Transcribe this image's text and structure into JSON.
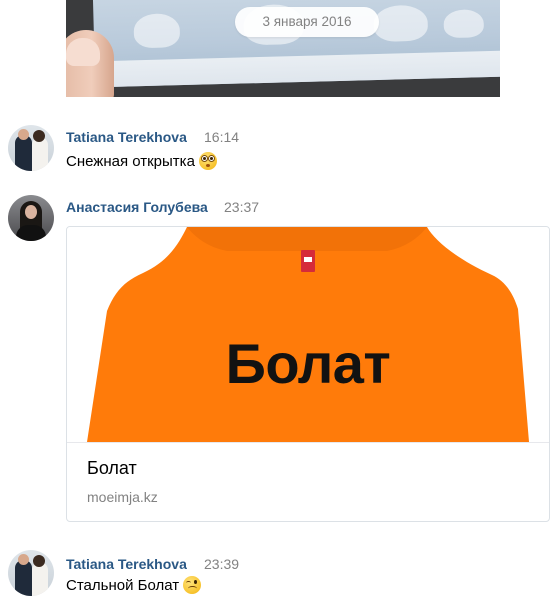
{
  "date_separator": "3 января 2016",
  "messages": [
    {
      "author": "Tatiana Terekhova",
      "time": "16:14",
      "text": "Снежная открытка",
      "emoji": "flushed-face-emoji"
    },
    {
      "author": "Анастасия Голубева",
      "time": "23:37",
      "link": {
        "image_text": "Болат",
        "title": "Болат",
        "domain": "moeimja.kz"
      }
    },
    {
      "author": "Tatiana Terekhova",
      "time": "23:39",
      "text": "Стальной Болат",
      "emoji": "winking-face-emoji"
    }
  ],
  "colors": {
    "author_link": "#2a5885",
    "muted_text": "#828282",
    "shirt_orange": "#ff7b0a",
    "card_border": "#dce1e6"
  },
  "icons": {
    "favorite": "star-icon"
  }
}
